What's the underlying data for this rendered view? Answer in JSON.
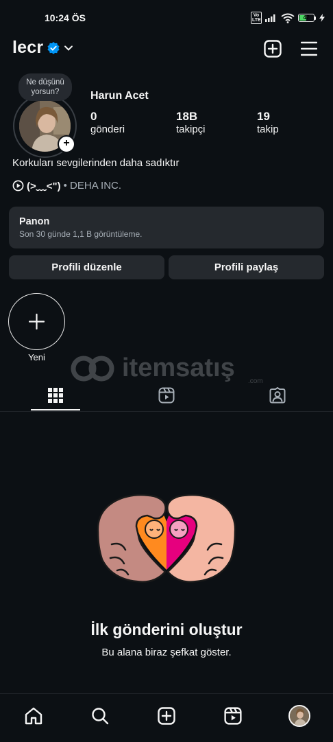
{
  "status_bar": {
    "time": "10:24 ÖS",
    "volte": "Vo LTE",
    "battery": "47",
    "battery_level": 0.47
  },
  "header": {
    "username": "lecr",
    "verified": true
  },
  "profile": {
    "note_placeholder": "Ne düşünü yorsun?",
    "full_name": "Harun Acet",
    "stats": [
      {
        "value": "0",
        "label": "gönderi"
      },
      {
        "value": "18B",
        "label": "takipçi"
      },
      {
        "value": "19",
        "label": "takip"
      }
    ],
    "bio": "Korkuları sevgilerinden daha sadıktır",
    "threads_handle": "(>﹏<\")",
    "threads_extra": "• DEHA INC."
  },
  "dashboard": {
    "title": "Panon",
    "subtitle": "Son 30 günde 1,1 B görüntüleme."
  },
  "buttons": {
    "edit_profile": "Profili düzenle",
    "share_profile": "Profili paylaş"
  },
  "highlights": {
    "new_label": "Yeni"
  },
  "watermark": {
    "text": "itemsatış",
    "suffix": ".com"
  },
  "tabs": [
    {
      "icon": "grid-icon",
      "active": true
    },
    {
      "icon": "reels-icon",
      "active": false
    },
    {
      "icon": "tagged-icon",
      "active": false
    }
  ],
  "empty_state": {
    "title": "İlk gönderini oluştur",
    "subtitle": "Bu alana biraz şefkat göster."
  },
  "bottom_nav": [
    {
      "icon": "home-icon"
    },
    {
      "icon": "search-icon"
    },
    {
      "icon": "create-icon"
    },
    {
      "icon": "reels-icon"
    },
    {
      "icon": "profile-avatar"
    }
  ],
  "colors": {
    "background": "#0c1014",
    "surface": "#25292e",
    "verified": "#0095f6",
    "heart_orange": "#ff8a1f",
    "heart_pink": "#e6007e",
    "skin": "#f2b5a1"
  }
}
